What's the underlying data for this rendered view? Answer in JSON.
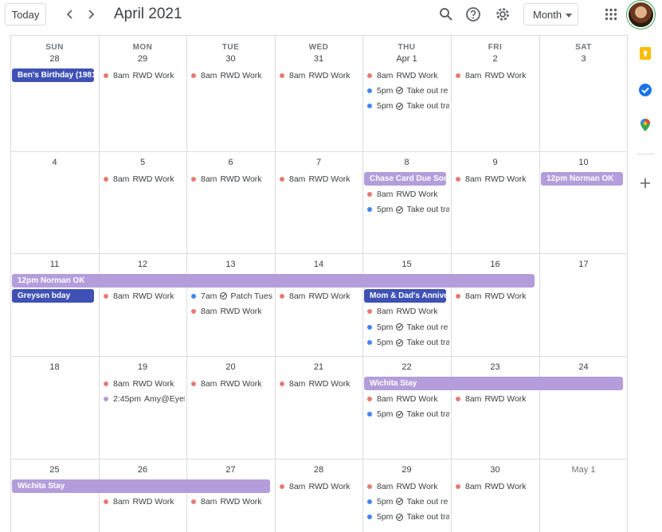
{
  "header": {
    "today_label": "Today",
    "title": "April 2021",
    "view_label": "Month"
  },
  "days_of_week": [
    "SUN",
    "MON",
    "TUE",
    "WED",
    "THU",
    "FRI",
    "SAT"
  ],
  "colors": {
    "work_dot": "#e67c73",
    "task_dot": "#4285f4",
    "lavender_dot": "#b39ddb",
    "lavender_pill": "#b39ddb",
    "blueberry_pill": "#3f51b5"
  },
  "weeks": [
    {
      "dates": [
        {
          "label": "28",
          "muted": false
        },
        {
          "label": "29",
          "muted": false
        },
        {
          "label": "30",
          "muted": false
        },
        {
          "label": "31",
          "muted": false
        },
        {
          "label": "Apr 1",
          "muted": false
        },
        {
          "label": "2",
          "muted": false
        },
        {
          "label": "3",
          "muted": false
        }
      ],
      "pills": [
        {
          "text": "Ben's Birthday (1981",
          "color": "blueberry_pill",
          "start": 0,
          "span": 1,
          "row": 0
        }
      ],
      "events": [
        {
          "day": 1,
          "row": 0,
          "time": "8am",
          "text": "RWD Work",
          "dot": "work_dot",
          "task": false
        },
        {
          "day": 2,
          "row": 0,
          "time": "8am",
          "text": "RWD Work",
          "dot": "work_dot",
          "task": false
        },
        {
          "day": 3,
          "row": 0,
          "time": "8am",
          "text": "RWD Work",
          "dot": "work_dot",
          "task": false
        },
        {
          "day": 4,
          "row": 0,
          "time": "8am",
          "text": "RWD Work",
          "dot": "work_dot",
          "task": false
        },
        {
          "day": 4,
          "row": 1,
          "time": "5pm",
          "text": "Take out re",
          "dot": "task_dot",
          "task": true
        },
        {
          "day": 4,
          "row": 2,
          "time": "5pm",
          "text": "Take out tra",
          "dot": "task_dot",
          "task": true
        },
        {
          "day": 5,
          "row": 0,
          "time": "8am",
          "text": "RWD Work",
          "dot": "work_dot",
          "task": false
        }
      ]
    },
    {
      "dates": [
        {
          "label": "4",
          "muted": false
        },
        {
          "label": "5",
          "muted": false
        },
        {
          "label": "6",
          "muted": false
        },
        {
          "label": "7",
          "muted": false
        },
        {
          "label": "8",
          "muted": false
        },
        {
          "label": "9",
          "muted": false
        },
        {
          "label": "10",
          "muted": false
        }
      ],
      "pills": [
        {
          "text": "Chase Card Due Soo",
          "color": "lavender_pill",
          "start": 4,
          "span": 1,
          "row": 0
        },
        {
          "text": "12pm Norman OK",
          "color": "lavender_pill",
          "start": 6,
          "span": 1,
          "row": 0
        }
      ],
      "events": [
        {
          "day": 1,
          "row": 0,
          "time": "8am",
          "text": "RWD Work",
          "dot": "work_dot",
          "task": false
        },
        {
          "day": 2,
          "row": 0,
          "time": "8am",
          "text": "RWD Work",
          "dot": "work_dot",
          "task": false
        },
        {
          "day": 3,
          "row": 0,
          "time": "8am",
          "text": "RWD Work",
          "dot": "work_dot",
          "task": false
        },
        {
          "day": 4,
          "row": 1,
          "time": "8am",
          "text": "RWD Work",
          "dot": "work_dot",
          "task": false
        },
        {
          "day": 4,
          "row": 2,
          "time": "5pm",
          "text": "Take out tra",
          "dot": "task_dot",
          "task": true
        },
        {
          "day": 5,
          "row": 0,
          "time": "8am",
          "text": "RWD Work",
          "dot": "work_dot",
          "task": false
        }
      ]
    },
    {
      "dates": [
        {
          "label": "11",
          "muted": false
        },
        {
          "label": "12",
          "muted": false
        },
        {
          "label": "13",
          "muted": false
        },
        {
          "label": "14",
          "muted": false
        },
        {
          "label": "15",
          "muted": false
        },
        {
          "label": "16",
          "muted": false
        },
        {
          "label": "17",
          "muted": false
        }
      ],
      "pills": [
        {
          "text": "12pm Norman OK",
          "color": "lavender_pill",
          "start": 0,
          "span": 6,
          "row": 0
        },
        {
          "text": "Greysen bday",
          "color": "blueberry_pill",
          "start": 0,
          "span": 1,
          "row": 1
        },
        {
          "text": "Mom & Dad's Anniver",
          "color": "blueberry_pill",
          "start": 4,
          "span": 1,
          "row": 1
        }
      ],
      "events": [
        {
          "day": 1,
          "row": 1,
          "time": "8am",
          "text": "RWD Work",
          "dot": "work_dot",
          "task": false
        },
        {
          "day": 2,
          "row": 1,
          "time": "7am",
          "text": "Patch Tues",
          "dot": "task_dot",
          "task": true
        },
        {
          "day": 2,
          "row": 2,
          "time": "8am",
          "text": "RWD Work",
          "dot": "work_dot",
          "task": false
        },
        {
          "day": 3,
          "row": 1,
          "time": "8am",
          "text": "RWD Work",
          "dot": "work_dot",
          "task": false
        },
        {
          "day": 4,
          "row": 2,
          "time": "8am",
          "text": "RWD Work",
          "dot": "work_dot",
          "task": false
        },
        {
          "day": 4,
          "row": 3,
          "time": "5pm",
          "text": "Take out re",
          "dot": "task_dot",
          "task": true
        },
        {
          "day": 4,
          "row": 4,
          "time": "5pm",
          "text": "Take out tra",
          "dot": "task_dot",
          "task": true
        },
        {
          "day": 5,
          "row": 1,
          "time": "8am",
          "text": "RWD Work",
          "dot": "work_dot",
          "task": false
        }
      ]
    },
    {
      "dates": [
        {
          "label": "18",
          "muted": false
        },
        {
          "label": "19",
          "muted": false
        },
        {
          "label": "20",
          "muted": false
        },
        {
          "label": "21",
          "muted": false
        },
        {
          "label": "22",
          "muted": false
        },
        {
          "label": "23",
          "muted": false
        },
        {
          "label": "24",
          "muted": false
        }
      ],
      "pills": [
        {
          "text": "Wichita Stay",
          "color": "lavender_pill",
          "start": 4,
          "span": 3,
          "row": 0
        }
      ],
      "events": [
        {
          "day": 1,
          "row": 0,
          "time": "8am",
          "text": "RWD Work",
          "dot": "work_dot",
          "task": false
        },
        {
          "day": 1,
          "row": 1,
          "time": "2:45pm",
          "text": "Amy@EyeD",
          "dot": "lavender_dot",
          "task": false
        },
        {
          "day": 2,
          "row": 0,
          "time": "8am",
          "text": "RWD Work",
          "dot": "work_dot",
          "task": false
        },
        {
          "day": 3,
          "row": 0,
          "time": "8am",
          "text": "RWD Work",
          "dot": "work_dot",
          "task": false
        },
        {
          "day": 4,
          "row": 1,
          "time": "8am",
          "text": "RWD Work",
          "dot": "work_dot",
          "task": false
        },
        {
          "day": 4,
          "row": 2,
          "time": "5pm",
          "text": "Take out tra",
          "dot": "task_dot",
          "task": true
        },
        {
          "day": 5,
          "row": 1,
          "time": "8am",
          "text": "RWD Work",
          "dot": "work_dot",
          "task": false
        }
      ]
    },
    {
      "dates": [
        {
          "label": "25",
          "muted": false
        },
        {
          "label": "26",
          "muted": false
        },
        {
          "label": "27",
          "muted": false
        },
        {
          "label": "28",
          "muted": false
        },
        {
          "label": "29",
          "muted": false
        },
        {
          "label": "30",
          "muted": false
        },
        {
          "label": "May 1",
          "muted": true
        }
      ],
      "pills": [
        {
          "text": "Wichita Stay",
          "color": "lavender_pill",
          "start": 0,
          "span": 3,
          "row": 0
        }
      ],
      "events": [
        {
          "day": 1,
          "row": 1,
          "time": "8am",
          "text": "RWD Work",
          "dot": "work_dot",
          "task": false
        },
        {
          "day": 2,
          "row": 1,
          "time": "8am",
          "text": "RWD Work",
          "dot": "work_dot",
          "task": false
        },
        {
          "day": 3,
          "row": 0,
          "time": "8am",
          "text": "RWD Work",
          "dot": "work_dot",
          "task": false
        },
        {
          "day": 4,
          "row": 0,
          "time": "8am",
          "text": "RWD Work",
          "dot": "work_dot",
          "task": false
        },
        {
          "day": 4,
          "row": 1,
          "time": "5pm",
          "text": "Take out re",
          "dot": "task_dot",
          "task": true
        },
        {
          "day": 4,
          "row": 2,
          "time": "5pm",
          "text": "Take out tra",
          "dot": "task_dot",
          "task": true
        },
        {
          "day": 5,
          "row": 0,
          "time": "8am",
          "text": "RWD Work",
          "dot": "work_dot",
          "task": false
        }
      ]
    }
  ],
  "side_panel": {
    "items": [
      {
        "icon": "keep-icon",
        "color": "#fbbc04"
      },
      {
        "icon": "tasks-icon",
        "color": "#1a73e8"
      },
      {
        "icon": "maps-icon",
        "color": "#34a853"
      }
    ],
    "add_icon": "plus-icon"
  }
}
